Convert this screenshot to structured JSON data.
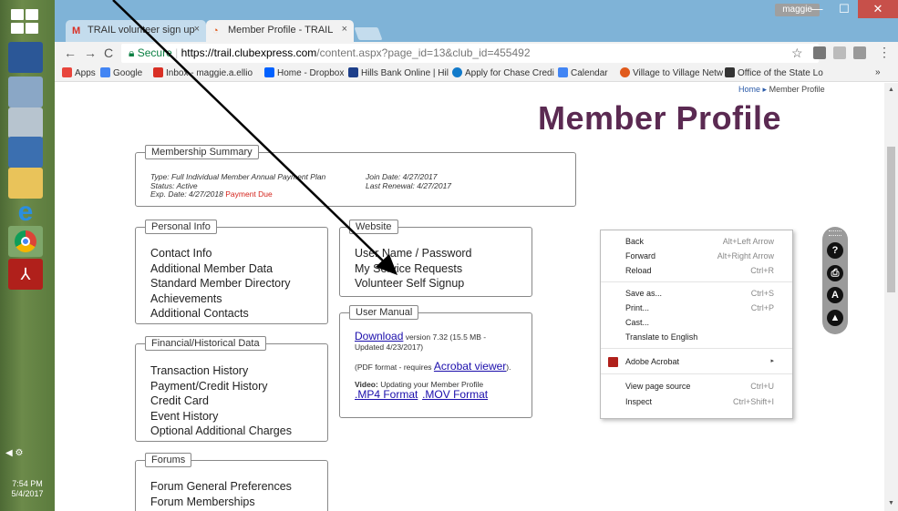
{
  "taskbar": {
    "clock_time": "7:54 PM",
    "clock_date": "5/4/2017"
  },
  "browser": {
    "tabs": [
      {
        "label": "TRAIL volunteer sign up",
        "icon": "gmail-icon",
        "close": "×"
      },
      {
        "label": "Member Profile - TRAIL",
        "icon": "club-icon",
        "close": "×"
      }
    ],
    "user_badge": "maggie",
    "window_controls": {
      "minimize": "—",
      "maximize": "☐",
      "close": "✕"
    },
    "url": {
      "security": "Secure",
      "host": "https://trail.clubexpress.com",
      "path": "/content.aspx?page_id=13&club_id=455492"
    },
    "bookmarks": [
      {
        "label": "Apps",
        "color": "#e8453c"
      },
      {
        "label": "Google",
        "color": "#4285f4"
      },
      {
        "label": "Inbox - maggie.a.ellio",
        "color": "#d93025"
      },
      {
        "label": "Home - Dropbox",
        "color": "#0061ff"
      },
      {
        "label": "Hills Bank Online | Hil",
        "color": "#1d3f8a"
      },
      {
        "label": "Apply for Chase Credi",
        "color": "#117aca"
      },
      {
        "label": "Calendar",
        "color": "#4285f4"
      },
      {
        "label": "Village to Village Netw",
        "color": "#e05a1c"
      },
      {
        "label": "Office of the State Lo",
        "color": "#333333"
      }
    ],
    "bookmarks_more": "»"
  },
  "page": {
    "breadcrumb": {
      "home": "Home",
      "sep": "▸",
      "current": "Member Profile"
    },
    "title": "Member Profile",
    "membership_summary": {
      "legend": "Membership Summary",
      "type": "Type: Full Individual Member Annual Payment Plan",
      "status": "Status: Active",
      "exp_label": "Exp. Date: 4/27/2018",
      "exp_warning": "Payment Due",
      "join_date": "Join Date: 4/27/2017",
      "last_renewal": "Last Renewal: 4/27/2017"
    },
    "personal_info": {
      "legend": "Personal Info",
      "links": [
        "Contact Info",
        "Additional Member Data",
        "Standard Member Directory",
        "Achievements",
        "Additional Contacts"
      ]
    },
    "website": {
      "legend": "Website",
      "links": [
        "User Name / Password",
        "My Service Requests",
        "Volunteer Self Signup"
      ]
    },
    "user_manual": {
      "legend": "User Manual",
      "download_link": "Download",
      "version_text": "version 7.32 (15.5 MB -",
      "updated_text": "Updated 4/23/2017)",
      "pdf_text": "(PDF format - requires",
      "acrobat_link": "Acrobat viewer",
      "pdf_end": ").",
      "video_label": "Video:",
      "video_text": "Updating your Member Profile",
      "mp4_link": ".MP4 Format",
      "mov_link": ".MOV Format"
    },
    "financial": {
      "legend": "Financial/Historical Data",
      "links": [
        "Transaction History",
        "Payment/Credit History",
        "Credit Card",
        "Event History",
        "Optional Additional Charges"
      ]
    },
    "forums": {
      "legend": "Forums",
      "links": [
        "Forum General Preferences",
        "Forum Memberships"
      ]
    }
  },
  "context_menu": {
    "items": [
      {
        "label": "Back",
        "shortcut": "Alt+Left Arrow"
      },
      {
        "label": "Forward",
        "shortcut": "Alt+Right Arrow"
      },
      {
        "label": "Reload",
        "shortcut": "Ctrl+R"
      },
      {
        "label": "Save as...",
        "shortcut": "Ctrl+S"
      },
      {
        "label": "Print...",
        "shortcut": "Ctrl+P"
      },
      {
        "label": "Cast...",
        "shortcut": ""
      },
      {
        "label": "Translate to English",
        "shortcut": ""
      },
      {
        "label": "Adobe Acrobat",
        "shortcut": "▸"
      },
      {
        "label": "View page source",
        "shortcut": "Ctrl+U"
      },
      {
        "label": "Inspect",
        "shortcut": "Ctrl+Shift+I"
      }
    ]
  },
  "toolpanel": {
    "buttons": [
      "?",
      "⎙",
      "A",
      "▲"
    ]
  }
}
